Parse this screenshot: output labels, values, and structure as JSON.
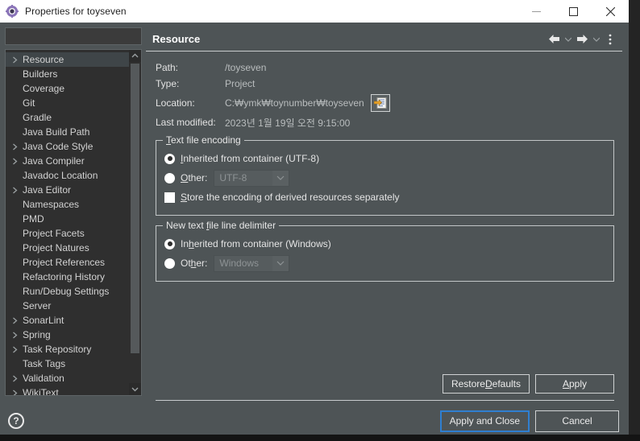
{
  "window": {
    "title": "Properties for toyseven",
    "icon": "properties-gear-icon",
    "minimize_label": "—",
    "maximize_label": "□",
    "close_label": "✕"
  },
  "sidebar": {
    "search": {
      "value": "",
      "placeholder": ""
    },
    "items": [
      {
        "label": "Resource",
        "expandable": true,
        "selected": true
      },
      {
        "label": "Builders",
        "expandable": false,
        "selected": false
      },
      {
        "label": "Coverage",
        "expandable": false,
        "selected": false
      },
      {
        "label": "Git",
        "expandable": false,
        "selected": false
      },
      {
        "label": "Gradle",
        "expandable": false,
        "selected": false
      },
      {
        "label": "Java Build Path",
        "expandable": false,
        "selected": false
      },
      {
        "label": "Java Code Style",
        "expandable": true,
        "selected": false
      },
      {
        "label": "Java Compiler",
        "expandable": true,
        "selected": false
      },
      {
        "label": "Javadoc Location",
        "expandable": false,
        "selected": false
      },
      {
        "label": "Java Editor",
        "expandable": true,
        "selected": false
      },
      {
        "label": "Namespaces",
        "expandable": false,
        "selected": false
      },
      {
        "label": "PMD",
        "expandable": false,
        "selected": false
      },
      {
        "label": "Project Facets",
        "expandable": false,
        "selected": false
      },
      {
        "label": "Project Natures",
        "expandable": false,
        "selected": false
      },
      {
        "label": "Project References",
        "expandable": false,
        "selected": false
      },
      {
        "label": "Refactoring History",
        "expandable": false,
        "selected": false
      },
      {
        "label": "Run/Debug Settings",
        "expandable": false,
        "selected": false
      },
      {
        "label": "Server",
        "expandable": false,
        "selected": false
      },
      {
        "label": "SonarLint",
        "expandable": true,
        "selected": false
      },
      {
        "label": "Spring",
        "expandable": true,
        "selected": false
      },
      {
        "label": "Task Repository",
        "expandable": true,
        "selected": false
      },
      {
        "label": "Task Tags",
        "expandable": false,
        "selected": false
      },
      {
        "label": "Validation",
        "expandable": true,
        "selected": false
      },
      {
        "label": "WikiText",
        "expandable": true,
        "selected": false
      }
    ],
    "scroll_up": "▲",
    "scroll_down": "▼"
  },
  "panel": {
    "title": "Resource",
    "back_label": "←",
    "back_menu_label": "▾",
    "forward_label": "→",
    "forward_menu_label": "▾",
    "view_menu_label": "⋮",
    "properties": [
      {
        "key": "Path:",
        "value": "/toyseven"
      },
      {
        "key": "Type:",
        "value": "Project"
      }
    ],
    "location": {
      "key": "Location:",
      "value": "C:₩ymk₩toynumber₩toyseven",
      "button_icon": "edit-location-icon"
    },
    "last_modified": {
      "key": "Last modified:",
      "value": "2023년 1월 19일 오전 9:15:00"
    },
    "encoding_group": {
      "title": "Text file encoding",
      "title_mnemonic": "T",
      "inherited": {
        "label": "Inherited from container (UTF-8)",
        "mnemonic": "I",
        "checked": true
      },
      "other": {
        "label": "Other:",
        "mnemonic": "O",
        "checked": false,
        "combo_value": "UTF-8",
        "combo_arrow": "⌄"
      },
      "store_separately": {
        "label": "Store the encoding of derived resources separately",
        "mnemonic": "S",
        "checked": false
      }
    },
    "delimiter_group": {
      "title": "New text file line delimiter",
      "title_mnemonic": "f",
      "inherited": {
        "label": "Inherited from container (Windows)",
        "mnemonic": "h",
        "checked": true
      },
      "other": {
        "label": "Other:",
        "mnemonic": "h",
        "checked": false,
        "combo_value": "Windows",
        "combo_arrow": "⌄"
      }
    },
    "restore_defaults_label": "Restore Defaults",
    "apply_label": "Apply"
  },
  "footer": {
    "help_label": "?",
    "apply_and_close_label": "Apply and Close",
    "cancel_label": "Cancel"
  },
  "colors": {
    "dialog_bg": "#4e5456",
    "tree_bg": "#2f2f2f",
    "titlebar_bg": "#ffffff",
    "focus_blue": "#2f7fd1",
    "text": "#e4e4e4"
  }
}
